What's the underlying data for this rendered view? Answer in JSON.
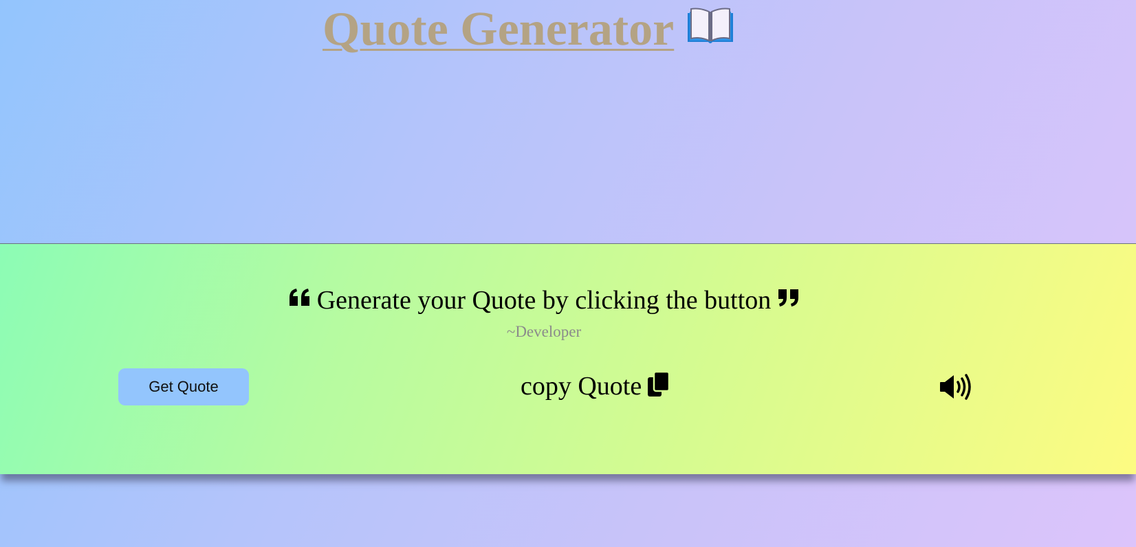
{
  "header": {
    "title": "Quote Generator",
    "title_icon": "open-book-icon",
    "title_color": "#b4a384"
  },
  "quote_card": {
    "quote_text": "Generate your Quote by clicking the button",
    "author": "~Developer",
    "left_quote_icon": "quote-left-icon",
    "right_quote_icon": "quote-right-icon"
  },
  "actions": {
    "get_quote_label": "Get Quote",
    "copy_quote_label": "copy Quote",
    "copy_icon": "copy-icon",
    "speak_icon": "speaker-icon"
  },
  "colors": {
    "button_bg": "#93c5fd",
    "card_gradient_start": "#8cfcb5",
    "card_gradient_end": "#fdfb82",
    "page_gradient_start": "#93c5fd",
    "page_gradient_end": "#dcc4fb"
  }
}
